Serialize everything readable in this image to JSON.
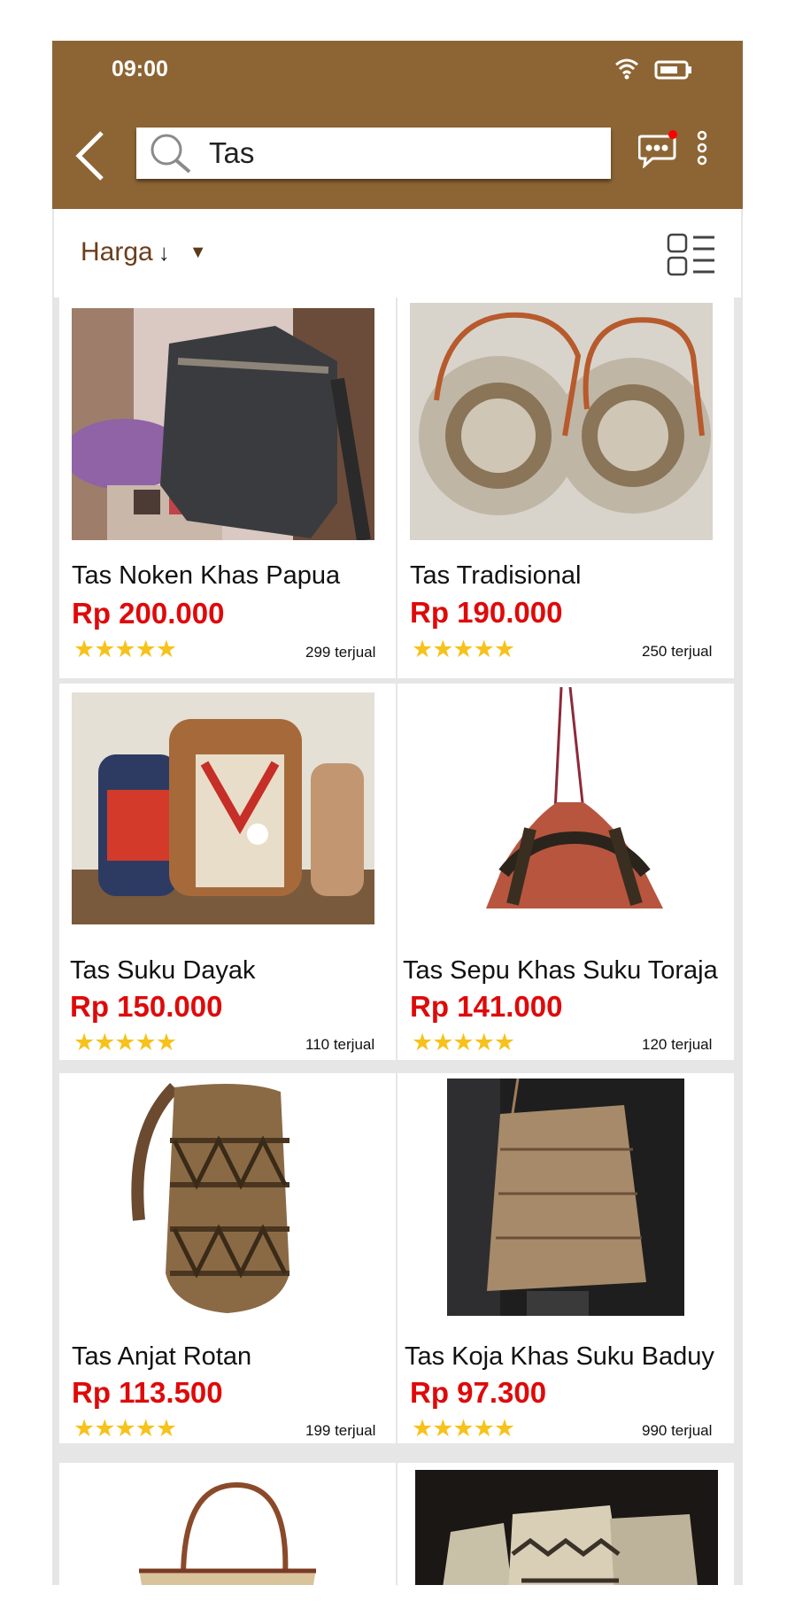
{
  "status_bar": {
    "time": "09:00"
  },
  "search": {
    "value": "Tas"
  },
  "icons": {
    "back": "chevron-left-icon",
    "search": "search-icon",
    "chat": "chat-bubble-icon",
    "more": "more-vertical-icon",
    "view_toggle": "list-view-icon",
    "wifi": "wifi-icon",
    "battery": "battery-icon"
  },
  "filter": {
    "sort_label": "Harga",
    "sort_arrow": "↓",
    "dropdown": "▼"
  },
  "colors": {
    "header": "#8d6534",
    "price": "#de0a0a",
    "star": "#f6c21b",
    "notification": "#ff0000"
  },
  "products": [
    {
      "name": "Tas Noken Khas Papua",
      "price": "Rp 200.000",
      "rating": 5,
      "stars": "★★★★★",
      "sold": "299 terjual"
    },
    {
      "name": "Tas Tradisional",
      "price": "Rp 190.000",
      "rating": 5,
      "stars": "★★★★★",
      "sold": "250 terjual"
    },
    {
      "name": "Tas Suku Dayak",
      "price": "Rp 150.000",
      "rating": 5,
      "stars": "★★★★★",
      "sold": "110 terjual"
    },
    {
      "name": "Tas Sepu Khas Suku Toraja",
      "price": "Rp 141.000",
      "rating": 5,
      "stars": "★★★★★",
      "sold": "120 terjual"
    },
    {
      "name": "Tas Anjat Rotan",
      "price": "Rp 113.500",
      "rating": 5,
      "stars": "★★★★★",
      "sold": "199 terjual"
    },
    {
      "name": "Tas Koja Khas Suku Baduy",
      "price": "Rp 97.300",
      "rating": 5,
      "stars": "★★★★★",
      "sold": "990 terjual"
    }
  ]
}
